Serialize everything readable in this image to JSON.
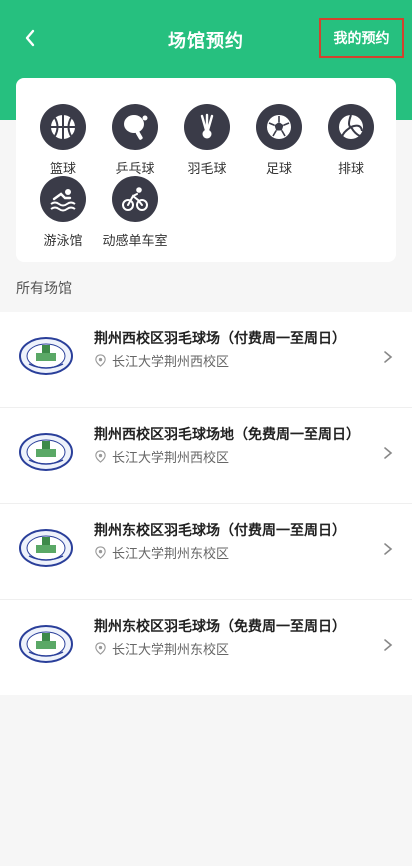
{
  "header": {
    "title": "场馆预约",
    "my_booking": "我的预约"
  },
  "categories": [
    {
      "label": "篮球",
      "icon": "basketball-icon"
    },
    {
      "label": "乒乓球",
      "icon": "ping-pong-icon"
    },
    {
      "label": "羽毛球",
      "icon": "badminton-icon"
    },
    {
      "label": "足球",
      "icon": "soccer-icon"
    },
    {
      "label": "排球",
      "icon": "volleyball-icon"
    },
    {
      "label": "游泳馆",
      "icon": "swimming-icon"
    },
    {
      "label": "动感单车室",
      "icon": "cycling-icon"
    }
  ],
  "section_title": "所有场馆",
  "venues": [
    {
      "name": "荆州西校区羽毛球场（付费周一至周日）",
      "location": "长江大学荆州西校区"
    },
    {
      "name": "荆州西校区羽毛球场地（免费周一至周日）",
      "location": "长江大学荆州西校区"
    },
    {
      "name": "荆州东校区羽毛球场（付费周一至周日）",
      "location": "长江大学荆州东校区"
    },
    {
      "name": "荆州东校区羽毛球场（免费周一至周日）",
      "location": "长江大学荆州东校区"
    }
  ],
  "logo_text": "YANGTZE UNIVERSITY",
  "colors": {
    "accent": "#26c07f",
    "icon_bg": "#3a3b48",
    "highlight": "#d3422e"
  }
}
